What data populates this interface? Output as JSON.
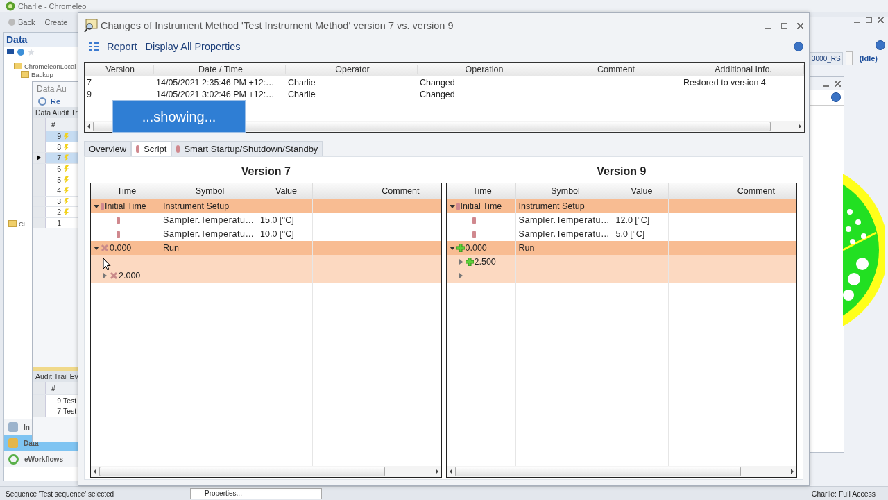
{
  "app": {
    "title": "Charlie - Chromeleo",
    "toolbar": [
      "Back",
      "Create"
    ],
    "panel_title": "Data",
    "tree": [
      {
        "label": "ChromeleonLocal"
      },
      {
        "label": "Backup"
      },
      {
        "label": "Cl"
      }
    ],
    "inner_window": {
      "title": "Data Au",
      "toolbar": "Re",
      "grid_title": "Data Audit Tr",
      "grid_column": "#",
      "rows": [
        {
          "number": "9",
          "flagged": true,
          "selected": true,
          "current": false
        },
        {
          "number": "8",
          "flagged": true,
          "selected": false,
          "current": false
        },
        {
          "number": "7",
          "flagged": true,
          "selected": true,
          "current": true
        },
        {
          "number": "6",
          "flagged": true,
          "selected": false,
          "current": false
        },
        {
          "number": "5",
          "flagged": true,
          "selected": false,
          "current": false
        },
        {
          "number": "4",
          "flagged": true,
          "selected": false,
          "current": false
        },
        {
          "number": "3",
          "flagged": true,
          "selected": false,
          "current": false
        },
        {
          "number": "2",
          "flagged": true,
          "selected": false,
          "current": false
        },
        {
          "number": "1",
          "flagged": false,
          "selected": false,
          "current": false
        }
      ],
      "events_title": "Audit Trail Ev",
      "events_column": "#",
      "events": [
        {
          "number": "9",
          "text": "Test"
        },
        {
          "number": "7",
          "text": "Test"
        }
      ]
    },
    "nav": [
      {
        "label": "In",
        "selected": false
      },
      {
        "label": "Data",
        "selected": true
      },
      {
        "label": "eWorkflows",
        "selected": false
      }
    ],
    "instrument": "3000_RS",
    "state": "(Idle)",
    "status_bar": {
      "message": "Sequence 'Test sequence' selected",
      "tab": "Properties...",
      "user": "Charlie: Full Access"
    }
  },
  "dialog": {
    "title": "Changes of Instrument Method 'Test Instrument Method' version 7 vs. version 9",
    "toolbar": [
      "Report",
      "Display All Properties"
    ],
    "versions": {
      "columns": [
        "Version",
        "Date / Time",
        "Operator",
        "Operation",
        "Comment",
        "Additional Info."
      ],
      "rows": [
        [
          "7",
          "14/05/2021  2:35:46  PM +12:…",
          "Charlie",
          "Changed",
          null,
          "Restored to version 4."
        ],
        [
          "9",
          "14/05/2021  3:02:46  PM +12:…",
          "Charlie",
          "Changed",
          null,
          null
        ]
      ]
    },
    "callout": "...showing...",
    "tabs": [
      {
        "label": "Overview",
        "icon": false,
        "selected": false
      },
      {
        "label": "Script",
        "icon": true,
        "selected": true
      },
      {
        "label": "Smart Startup/Shutdown/Standby",
        "icon": true,
        "selected": false
      }
    ],
    "panes": [
      {
        "title": "Version 7",
        "columns": [
          "Time",
          "Symbol",
          "Value",
          "Comment"
        ],
        "rows": [
          {
            "time": "Initial Time",
            "symbol": "Instrument Setup",
            "kind": "setup",
            "expanded": true,
            "children": [
              {
                "symbol": "Sampler.Temperatu…",
                "value": "15.0 [°C]",
                "kind": "setup"
              },
              {
                "symbol": "Sampler.Temperatu…",
                "value": "10.0 [°C]",
                "kind": "setup"
              }
            ]
          },
          {
            "time": "0.000",
            "symbol": "Run",
            "kind": "removed",
            "expanded": true,
            "children": [
              {
                "kind": "blank",
                "expanded": false
              },
              {
                "time": "2.000",
                "kind": "removed",
                "expanded": false
              }
            ]
          }
        ]
      },
      {
        "title": "Version 9",
        "columns": [
          "Time",
          "Symbol",
          "Value",
          "Comment"
        ],
        "rows": [
          {
            "time": "Initial Time",
            "symbol": "Instrument Setup",
            "kind": "setup",
            "expanded": true,
            "children": [
              {
                "symbol": "Sampler.Temperatu…",
                "value": "12.0 [°C]",
                "kind": "setup"
              },
              {
                "symbol": "Sampler.Temperatu…",
                "value": "5.0 [°C]",
                "kind": "setup"
              }
            ]
          },
          {
            "time": "0.000",
            "symbol": "Run",
            "kind": "added",
            "expanded": true,
            "children": [
              {
                "time": "2.500",
                "kind": "added",
                "expanded": false
              },
              {
                "kind": "blank",
                "expanded": false
              }
            ]
          }
        ]
      }
    ]
  }
}
